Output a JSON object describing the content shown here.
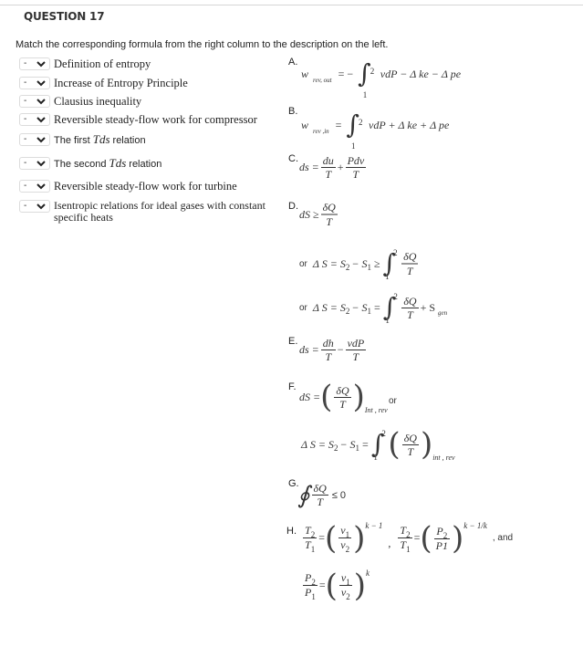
{
  "question": {
    "title": "QUESTION 17",
    "instructions": "Match the corresponding formula from the right column to the description on the left."
  },
  "select_default": "-",
  "descriptions": [
    {
      "label": "Definition of entropy"
    },
    {
      "label": "Increase of Entropy Principle"
    },
    {
      "label": "Clausius inequality"
    },
    {
      "label": "Reversible steady-flow work for compressor"
    },
    {
      "label_pre": "The first",
      "label_tds": "Tds",
      "label_post": "relation"
    },
    {
      "label_pre": "The second",
      "label_tds": "Tds",
      "label_post": "relation"
    },
    {
      "label": "Reversible steady-flow work for turbine"
    },
    {
      "label": "Isentropic relations for ideal gases with constant specific heats"
    }
  ],
  "options": {
    "A": {
      "letter": "A.",
      "lhs": "w",
      "sub": "rev, out",
      "eq": "= −",
      "int_lower": "1",
      "int_upper": "2",
      "rhs": "vdP − Δ ke − Δ pe"
    },
    "B": {
      "letter": "B.",
      "lhs": "w",
      "sub": "rev ,in",
      "eq": "=",
      "int_lower": "1",
      "int_upper": "2",
      "rhs": "vdP + Δ ke + Δ pe"
    },
    "C": {
      "letter": "C.",
      "lhs": "ds =",
      "f1_num": "du",
      "f1_den": "T",
      "op": "+",
      "f2_num": "Pdv",
      "f2_den": "T"
    },
    "D": {
      "letter": "D.",
      "lhs": "dS ≥",
      "num": "δQ",
      "den": "T",
      "or1_word": "or",
      "or1_lhs": "Δ S = S",
      "or1_s2": "2",
      "or1_mid": "− S",
      "or1_s1": "1",
      "or1_rel": "≥",
      "or1_num": "δQ",
      "or1_den": "T",
      "or2_word": "or",
      "or2_lhs": "Δ S = S",
      "or2_s2": "2",
      "or2_mid": "− S",
      "or2_s1": "1",
      "or2_rel": "=",
      "or2_num": "δQ",
      "or2_den": "T",
      "or2_tail": "+ S",
      "or2_tail_sub": "gen",
      "int_lower": "1",
      "int_upper": "2"
    },
    "E": {
      "letter": "E.",
      "lhs": "ds =",
      "f1_num": "dh",
      "f1_den": "T",
      "op": "−",
      "f2_num": "vdP",
      "f2_den": "T"
    },
    "F": {
      "letter": "F.",
      "lhs": "dS =",
      "num": "δQ",
      "den": "T",
      "sub": "Int , rev",
      "or_word": "or",
      "alt_lhs": "Δ S = S",
      "alt_s2": "2",
      "alt_mid": "− S",
      "alt_s1": "1",
      "alt_eq": "=",
      "alt_num": "δQ",
      "alt_den": "T",
      "alt_sub": "int , rev",
      "int_lower": "1",
      "int_upper": "2"
    },
    "G": {
      "letter": "G.",
      "num": "δQ",
      "den": "T",
      "rel": "≤ 0",
      "integral": "∮"
    },
    "H": {
      "letter": "H.",
      "r1_lhs_num": "T",
      "r1_lhs_num_sub": "2",
      "r1_lhs_den": "T",
      "r1_lhs_den_sub": "1",
      "r1_rhs_num": "v",
      "r1_rhs_num_sub": "1",
      "r1_rhs_den": "v",
      "r1_rhs_den_sub": "2",
      "r1_exp": "k − 1",
      "comma": ",",
      "r2_lhs_num": "T",
      "r2_lhs_num_sub": "2",
      "r2_lhs_den": "T",
      "r2_lhs_den_sub": "1",
      "r2_rhs_num": "P",
      "r2_rhs_num_sub": "2",
      "r2_rhs_den": "P1",
      "r2_exp": "k − 1/k",
      "and_word": ", and",
      "r3_lhs_num": "P",
      "r3_lhs_num_sub": "2",
      "r3_lhs_den": "P",
      "r3_lhs_den_sub": "1",
      "r3_rhs_num": "v",
      "r3_rhs_num_sub": "1",
      "r3_rhs_den": "v",
      "r3_rhs_den_sub": "2",
      "r3_exp": "k"
    }
  }
}
